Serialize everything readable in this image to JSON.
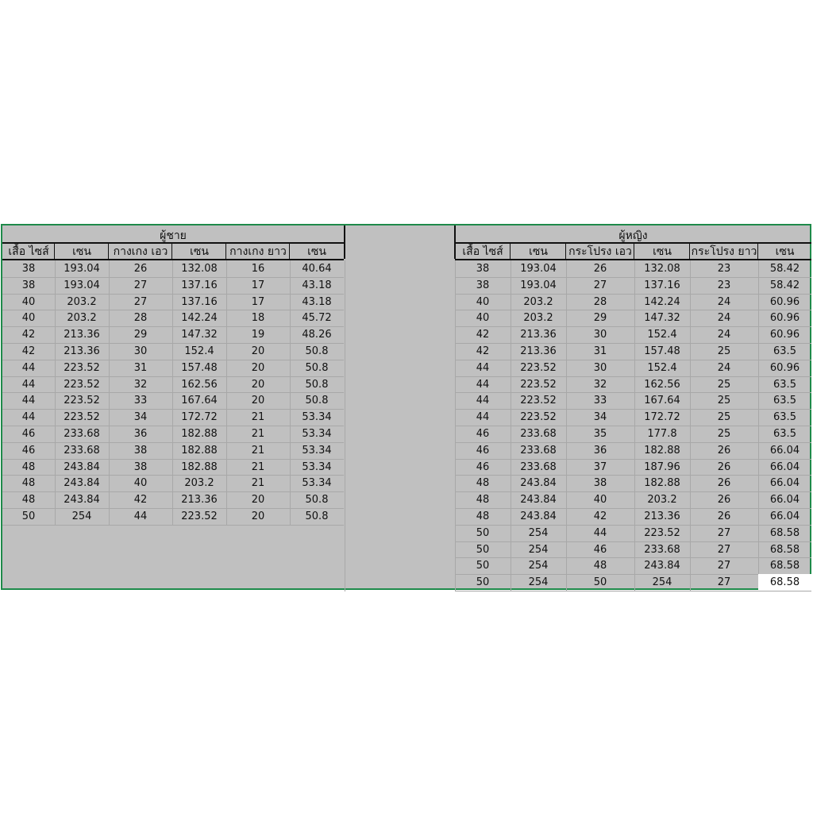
{
  "men": {
    "title": "ผู้ชาย",
    "headers": [
      "เสื้อ ไซส์",
      "เซน",
      "กางเกง เอว",
      "เซน",
      "กางเกง ยาว",
      "เซน"
    ],
    "rows": [
      [
        "38",
        "193.04",
        "26",
        "132.08",
        "16",
        "40.64"
      ],
      [
        "38",
        "193.04",
        "27",
        "137.16",
        "17",
        "43.18"
      ],
      [
        "40",
        "203.2",
        "27",
        "137.16",
        "17",
        "43.18"
      ],
      [
        "40",
        "203.2",
        "28",
        "142.24",
        "18",
        "45.72"
      ],
      [
        "42",
        "213.36",
        "29",
        "147.32",
        "19",
        "48.26"
      ],
      [
        "42",
        "213.36",
        "30",
        "152.4",
        "20",
        "50.8"
      ],
      [
        "44",
        "223.52",
        "31",
        "157.48",
        "20",
        "50.8"
      ],
      [
        "44",
        "223.52",
        "32",
        "162.56",
        "20",
        "50.8"
      ],
      [
        "44",
        "223.52",
        "33",
        "167.64",
        "20",
        "50.8"
      ],
      [
        "44",
        "223.52",
        "34",
        "172.72",
        "21",
        "53.34"
      ],
      [
        "46",
        "233.68",
        "36",
        "182.88",
        "21",
        "53.34"
      ],
      [
        "46",
        "233.68",
        "38",
        "182.88",
        "21",
        "53.34"
      ],
      [
        "48",
        "243.84",
        "38",
        "182.88",
        "21",
        "53.34"
      ],
      [
        "48",
        "243.84",
        "40",
        "203.2",
        "21",
        "53.34"
      ],
      [
        "48",
        "243.84",
        "42",
        "213.36",
        "20",
        "50.8"
      ],
      [
        "50",
        "254",
        "44",
        "223.52",
        "20",
        "50.8"
      ]
    ]
  },
  "women": {
    "title": "ผู้หญิง",
    "headers": [
      "เสื้อ ไซส์",
      "เซน",
      "กระโปรง เอว",
      "เซน",
      "กระโปรง ยาว",
      "เซน"
    ],
    "rows": [
      [
        "38",
        "193.04",
        "26",
        "132.08",
        "23",
        "58.42"
      ],
      [
        "38",
        "193.04",
        "27",
        "137.16",
        "23",
        "58.42"
      ],
      [
        "40",
        "203.2",
        "28",
        "142.24",
        "24",
        "60.96"
      ],
      [
        "40",
        "203.2",
        "29",
        "147.32",
        "24",
        "60.96"
      ],
      [
        "42",
        "213.36",
        "30",
        "152.4",
        "24",
        "60.96"
      ],
      [
        "42",
        "213.36",
        "31",
        "157.48",
        "25",
        "63.5"
      ],
      [
        "44",
        "223.52",
        "30",
        "152.4",
        "24",
        "60.96"
      ],
      [
        "44",
        "223.52",
        "32",
        "162.56",
        "25",
        "63.5"
      ],
      [
        "44",
        "223.52",
        "33",
        "167.64",
        "25",
        "63.5"
      ],
      [
        "44",
        "223.52",
        "34",
        "172.72",
        "25",
        "63.5"
      ],
      [
        "46",
        "233.68",
        "35",
        "177.8",
        "25",
        "63.5"
      ],
      [
        "46",
        "233.68",
        "36",
        "182.88",
        "26",
        "66.04"
      ],
      [
        "46",
        "233.68",
        "37",
        "187.96",
        "26",
        "66.04"
      ],
      [
        "48",
        "243.84",
        "38",
        "182.88",
        "26",
        "66.04"
      ],
      [
        "48",
        "243.84",
        "40",
        "203.2",
        "26",
        "66.04"
      ],
      [
        "48",
        "243.84",
        "42",
        "213.36",
        "26",
        "66.04"
      ],
      [
        "50",
        "254",
        "44",
        "223.52",
        "27",
        "68.58"
      ],
      [
        "50",
        "254",
        "46",
        "233.68",
        "27",
        "68.58"
      ],
      [
        "50",
        "254",
        "48",
        "243.84",
        "27",
        "68.58"
      ],
      [
        "50",
        "254",
        "50",
        "254",
        "27",
        "68.58"
      ]
    ]
  },
  "colors": {
    "sheet_bg": "#c0c0c0",
    "frame": "#1e8a4a",
    "selected_cell": "#ffffff"
  }
}
